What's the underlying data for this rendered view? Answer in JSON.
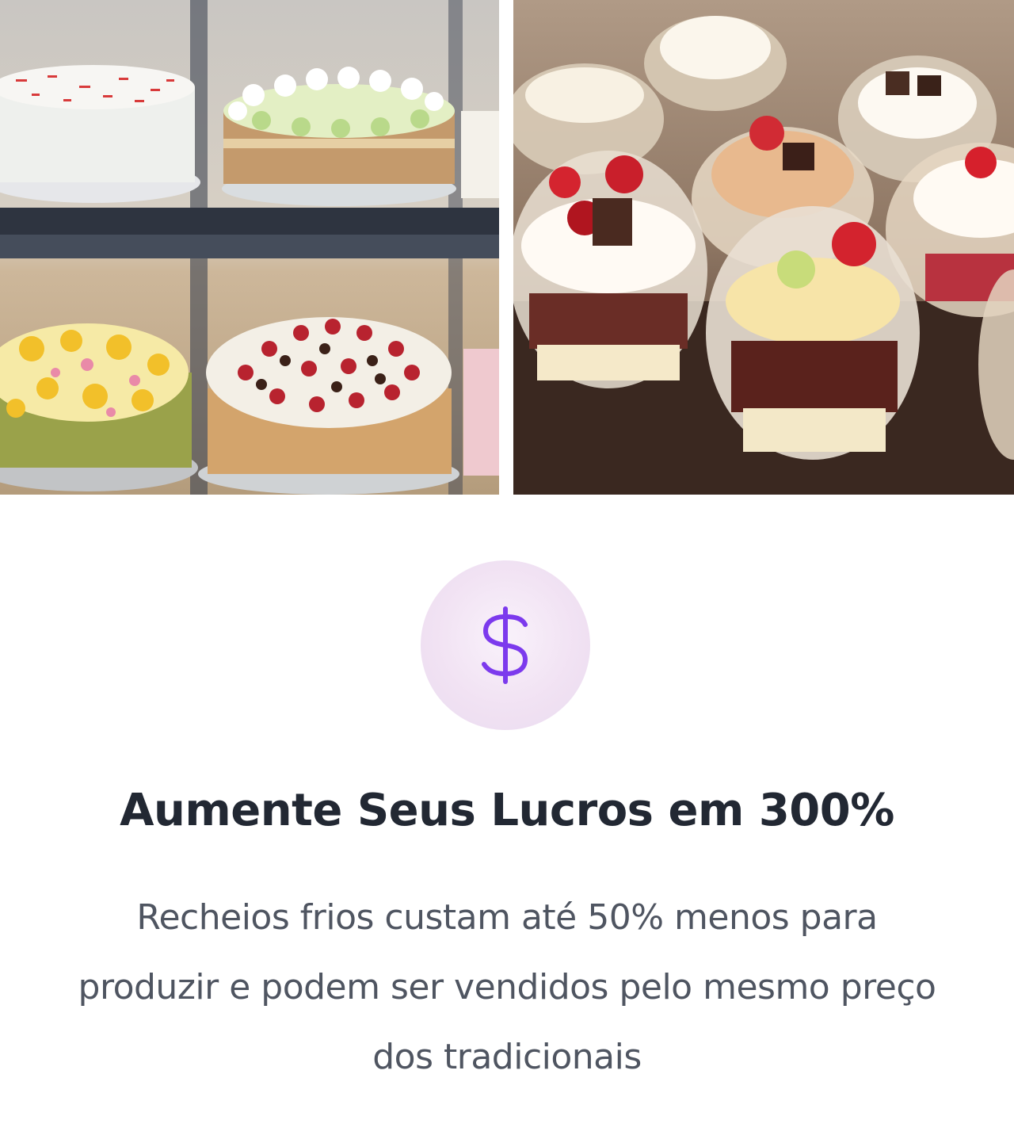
{
  "images": {
    "left": {
      "icon": "cakes-display-photo"
    },
    "right": {
      "icon": "dessert-cups-photo"
    }
  },
  "feature": {
    "icon": "dollar-icon",
    "icon_color": "#7c3aed",
    "title": "Aumente Seus Lucros em 300%",
    "description": "Recheios frios custam até 50% menos para produzir e podem ser vendidos pelo mesmo preço dos tradicionais"
  }
}
